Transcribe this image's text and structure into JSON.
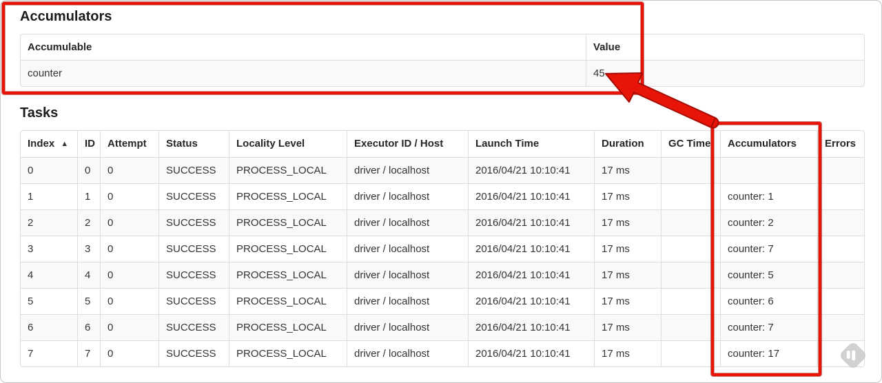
{
  "annotation_color": "#e91408",
  "annotation_outline_color": "#a50b02",
  "accumulators": {
    "heading": "Accumulators",
    "columns": [
      "Accumulable",
      "Value"
    ],
    "rows": [
      [
        "counter",
        "45"
      ]
    ]
  },
  "tasks": {
    "heading": "Tasks",
    "columns": [
      {
        "label": "Index",
        "sort": "▲"
      },
      {
        "label": "ID",
        "sort": ""
      },
      {
        "label": "Attempt",
        "sort": ""
      },
      {
        "label": "Status",
        "sort": ""
      },
      {
        "label": "Locality Level",
        "sort": ""
      },
      {
        "label": "Executor ID / Host",
        "sort": ""
      },
      {
        "label": "Launch Time",
        "sort": ""
      },
      {
        "label": "Duration",
        "sort": ""
      },
      {
        "label": "GC Time",
        "sort": ""
      },
      {
        "label": "Accumulators",
        "sort": ""
      },
      {
        "label": "Errors",
        "sort": ""
      }
    ],
    "rows": [
      [
        "0",
        "0",
        "0",
        "SUCCESS",
        "PROCESS_LOCAL",
        "driver / localhost",
        "2016/04/21 10:10:41",
        "17 ms",
        "",
        "",
        ""
      ],
      [
        "1",
        "1",
        "0",
        "SUCCESS",
        "PROCESS_LOCAL",
        "driver / localhost",
        "2016/04/21 10:10:41",
        "17 ms",
        "",
        "counter: 1",
        ""
      ],
      [
        "2",
        "2",
        "0",
        "SUCCESS",
        "PROCESS_LOCAL",
        "driver / localhost",
        "2016/04/21 10:10:41",
        "17 ms",
        "",
        "counter: 2",
        ""
      ],
      [
        "3",
        "3",
        "0",
        "SUCCESS",
        "PROCESS_LOCAL",
        "driver / localhost",
        "2016/04/21 10:10:41",
        "17 ms",
        "",
        "counter: 7",
        ""
      ],
      [
        "4",
        "4",
        "0",
        "SUCCESS",
        "PROCESS_LOCAL",
        "driver / localhost",
        "2016/04/21 10:10:41",
        "17 ms",
        "",
        "counter: 5",
        ""
      ],
      [
        "5",
        "5",
        "0",
        "SUCCESS",
        "PROCESS_LOCAL",
        "driver / localhost",
        "2016/04/21 10:10:41",
        "17 ms",
        "",
        "counter: 6",
        ""
      ],
      [
        "6",
        "6",
        "0",
        "SUCCESS",
        "PROCESS_LOCAL",
        "driver / localhost",
        "2016/04/21 10:10:41",
        "17 ms",
        "",
        "counter: 7",
        ""
      ],
      [
        "7",
        "7",
        "0",
        "SUCCESS",
        "PROCESS_LOCAL",
        "driver / localhost",
        "2016/04/21 10:10:41",
        "17 ms",
        "",
        "counter: 17",
        ""
      ]
    ]
  },
  "icons": {
    "sort_ascending": "sort-ascending-icon",
    "watermark": "feedly-watermark-icon"
  }
}
